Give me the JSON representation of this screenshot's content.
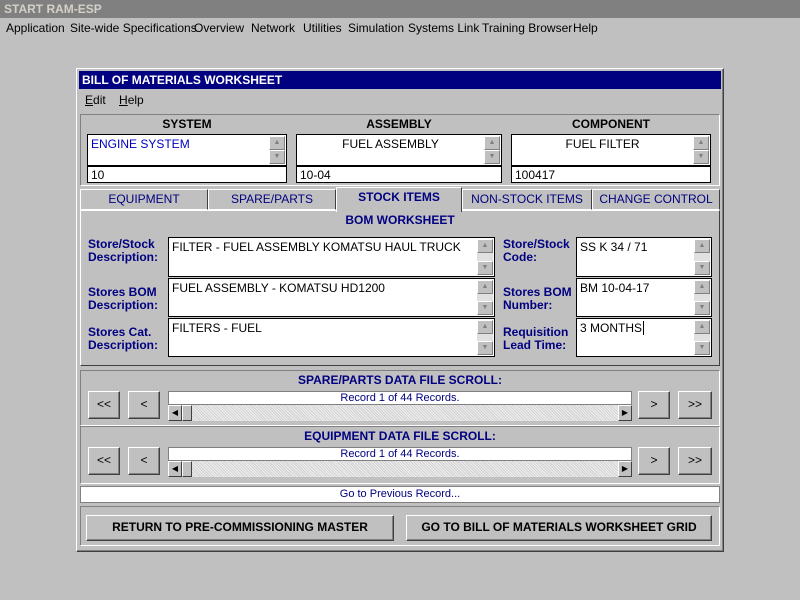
{
  "app_title": "START RAM-ESP",
  "menu": [
    "Application",
    "Site-wide Specifications",
    "Overview",
    "Network",
    "Utilities",
    "Simulation",
    "Systems Link",
    "Training Browser",
    "Help"
  ],
  "window": {
    "title": "BILL OF MATERIALS WORKSHEET",
    "menu": [
      {
        "ul": "E",
        "rest": "dit"
      },
      {
        "ul": "H",
        "rest": "elp"
      }
    ]
  },
  "system": {
    "header": "SYSTEM",
    "name": "ENGINE SYSTEM",
    "code": "10"
  },
  "assembly": {
    "header": "ASSEMBLY",
    "name": "FUEL ASSEMBLY",
    "code": "10-04"
  },
  "component": {
    "header": "COMPONENT",
    "name": "FUEL FILTER",
    "code": "100417"
  },
  "tabs": [
    "EQUIPMENT",
    "SPARE/PARTS",
    "STOCK ITEMS",
    "NON-STOCK ITEMS",
    "CHANGE CONTROL"
  ],
  "worksheet_title": "BOM WORKSHEET",
  "fields": {
    "store_stock_desc_label": "Store/Stock Description:",
    "store_stock_desc": "FILTER - FUEL ASSEMBLY KOMATSU HAUL TRUCK",
    "stores_bom_desc_label": "Stores BOM Description:",
    "stores_bom_desc": "FUEL ASSEMBLY - KOMATSU HD1200",
    "stores_cat_desc_label": "Stores Cat. Description:",
    "stores_cat_desc": "FILTERS - FUEL",
    "store_stock_code_label": "Store/Stock Code:",
    "store_stock_code": "SS K 34 / 71",
    "stores_bom_number_label": "Stores BOM Number:",
    "stores_bom_number": "BM 10-04-17",
    "req_lead_time_label": "Requisition Lead Time:",
    "req_lead_time": "3 MONTHS"
  },
  "spare_scroll": {
    "title": "SPARE/PARTS DATA FILE SCROLL:",
    "record": "Record 1 of 44 Records."
  },
  "equip_scroll": {
    "title": "EQUIPMENT DATA FILE SCROLL:",
    "record": "Record 1 of 44 Records."
  },
  "nav": {
    "first": "<<",
    "prev": "<",
    "next": ">",
    "last": ">>"
  },
  "status": "Go to Previous Record...",
  "buttons": {
    "return": "RETURN TO PRE-COMMISSIONING MASTER",
    "grid": "GO TO BILL OF MATERIALS WORKSHEET GRID"
  }
}
